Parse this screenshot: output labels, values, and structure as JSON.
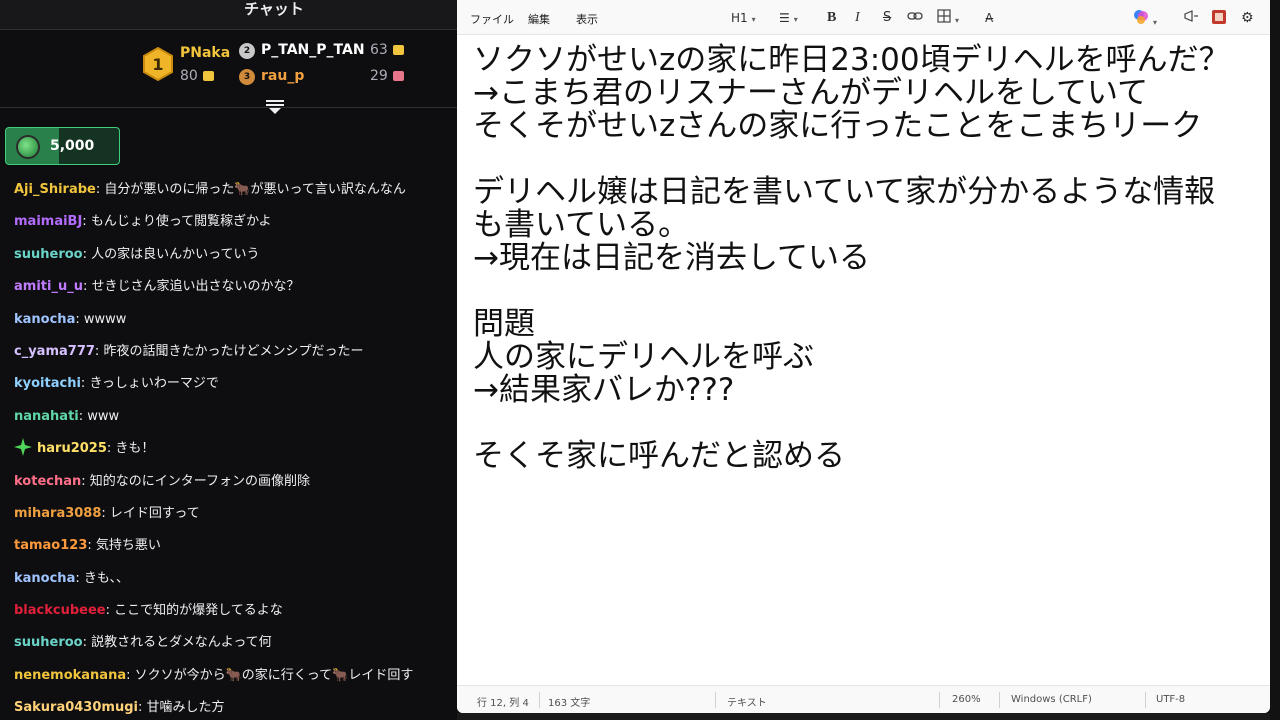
{
  "chat": {
    "title": "チャット",
    "leaderboard": {
      "first": {
        "rank": "1",
        "name": "PNaka",
        "count": "80"
      },
      "second": {
        "rank": "2",
        "name": "P_TAN_P_TAN",
        "count": "63"
      },
      "third": {
        "rank": "3",
        "name": "rau_p",
        "count": "29"
      }
    },
    "points": {
      "value": "5,000",
      "fill_fraction": 0.47
    },
    "messages": [
      {
        "user": "Aji_Shirabe",
        "color": "#f0c43c",
        "text": "自分が悪いのに帰った🐂が悪いって言い訳なんなん",
        "badge": ""
      },
      {
        "user": "maimaiBJ",
        "color": "#b46cff",
        "text": "もんじょり使って閲覧稼ぎかよ",
        "badge": ""
      },
      {
        "user": "suuheroo",
        "color": "#6ad3c8",
        "text": "人の家は良いんかいっていう",
        "badge": ""
      },
      {
        "user": "amiti_u_u",
        "color": "#c07cff",
        "text": "せきじさん家追い出さないのかな？",
        "badge": ""
      },
      {
        "user": "kanocha",
        "color": "#9fc4ff",
        "text": "wwww",
        "badge": ""
      },
      {
        "user": "c_yama777",
        "color": "#d6c0ff",
        "text": "昨夜の話聞きたかったけどメンシプだったー",
        "badge": ""
      },
      {
        "user": "kyoitachi",
        "color": "#8fd0ff",
        "text": "きっしょいわーマジで",
        "badge": ""
      },
      {
        "user": "nanahati",
        "color": "#5fd6a8",
        "text": "www",
        "badge": ""
      },
      {
        "user": "haru2025",
        "color": "#ffe066",
        "text": "きも！",
        "badge": "sparkle"
      },
      {
        "user": "kotechan",
        "color": "#ff6f8a",
        "text": "知的なのにインターフォンの画像削除",
        "badge": ""
      },
      {
        "user": "mihara3088",
        "color": "#f0a040",
        "text": "レイド回すって",
        "badge": ""
      },
      {
        "user": "tamao123",
        "color": "#ff9a3c",
        "text": "気持ち悪い",
        "badge": ""
      },
      {
        "user": "kanocha",
        "color": "#9fc4ff",
        "text": "きも、、",
        "badge": ""
      },
      {
        "user": "blackcubeee",
        "color": "#e0203a",
        "text": "ここで知的が爆発してるよな",
        "badge": ""
      },
      {
        "user": "suuheroo",
        "color": "#6ad3c8",
        "text": "説教されるとダメなんよって何",
        "badge": ""
      },
      {
        "user": "nenemokanana",
        "color": "#f0c43c",
        "text": "ソクソが今から🐂の家に行くって🐂レイド回す",
        "badge": ""
      },
      {
        "user": "Sakura0430mugi",
        "color": "#ffd27a",
        "text": "甘噛みした方",
        "badge": ""
      }
    ]
  },
  "notepad": {
    "menu": {
      "file": "ファイル",
      "edit": "編集",
      "view": "表示"
    },
    "toolbar": {
      "heading": "H1"
    },
    "lines": [
      "ソクソがせいzの家に昨日23:00頃デリヘルを呼んだ？",
      "→こまち君のリスナーさんがデリヘルをしていて",
      "そくそがせいzさんの家に行ったことをこまちリーク",
      "",
      "デリヘル嬢は日記を書いていて家が分かるような情報",
      "も書いている。",
      "→現在は日記を消去している",
      "",
      "問題",
      "人の家にデリヘルを呼ぶ",
      "→結果家バレか???",
      "",
      "そくそ家に呼んだと認める"
    ],
    "status": {
      "position": "行 12, 列 4",
      "chars": "163 文字",
      "format": "テキスト",
      "zoom": "260%",
      "line_ending": "Windows (CRLF)",
      "encoding": "UTF-8"
    }
  },
  "colors": {
    "chat_bg": "#0e0e10",
    "notepad_bg": "#ffffff",
    "points_accent": "#3fcf7c",
    "gold": "#f0c43c"
  }
}
